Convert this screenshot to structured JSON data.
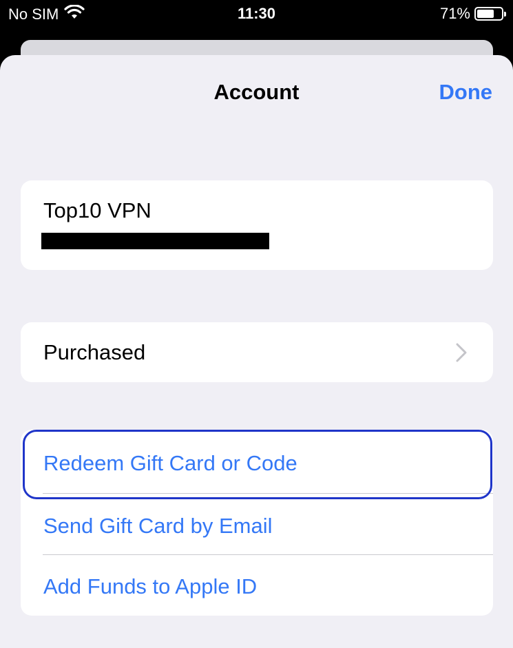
{
  "status_bar": {
    "carrier": "No SIM",
    "time": "11:30",
    "battery_percent": "71%",
    "battery_level": 0.71,
    "wifi_icon": "wifi-icon",
    "battery_icon": "battery-icon"
  },
  "header": {
    "title": "Account",
    "done_label": "Done"
  },
  "account": {
    "name": "Top10 VPN"
  },
  "purchased": {
    "label": "Purchased",
    "icon": "chevron-right-icon"
  },
  "gift_section": {
    "items": [
      {
        "label": "Redeem Gift Card or Code"
      },
      {
        "label": "Send Gift Card by Email"
      },
      {
        "label": "Add Funds to Apple ID"
      }
    ]
  },
  "colors": {
    "accent": "#3478f6",
    "focus_ring": "#1f35c9",
    "background": "#f0eff5"
  }
}
